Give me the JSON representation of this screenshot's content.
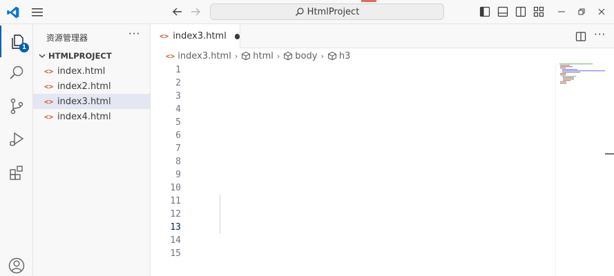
{
  "titlebar": {
    "search_text": "HtmlProject",
    "accent_color": "#005fb8"
  },
  "activity": {
    "explorer_badge": "1",
    "items": [
      "files-icon",
      "search-icon",
      "source-control-icon",
      "run-debug-icon",
      "extensions-icon",
      "account-icon"
    ]
  },
  "sidebar": {
    "title": "资源管理器",
    "more": "···",
    "folder": "HTMLPROJECT",
    "files": [
      {
        "name": "index.html",
        "icon": "<>"
      },
      {
        "name": "index2.html",
        "icon": "<>"
      },
      {
        "name": "index3.html",
        "icon": "<>"
      },
      {
        "name": "index4.html",
        "icon": "<>"
      }
    ]
  },
  "editor": {
    "tab_label": "index3.html",
    "tab_icon": "<>",
    "breadcrumb": {
      "file": "index3.html",
      "items": [
        "html",
        "body",
        "h3"
      ]
    },
    "active_line": 13,
    "line_numbers": [
      "1",
      "2",
      "3",
      "4",
      "5",
      "6",
      "7",
      "8",
      "9",
      "10",
      "11",
      "12",
      "13",
      "14",
      "15"
    ]
  }
}
